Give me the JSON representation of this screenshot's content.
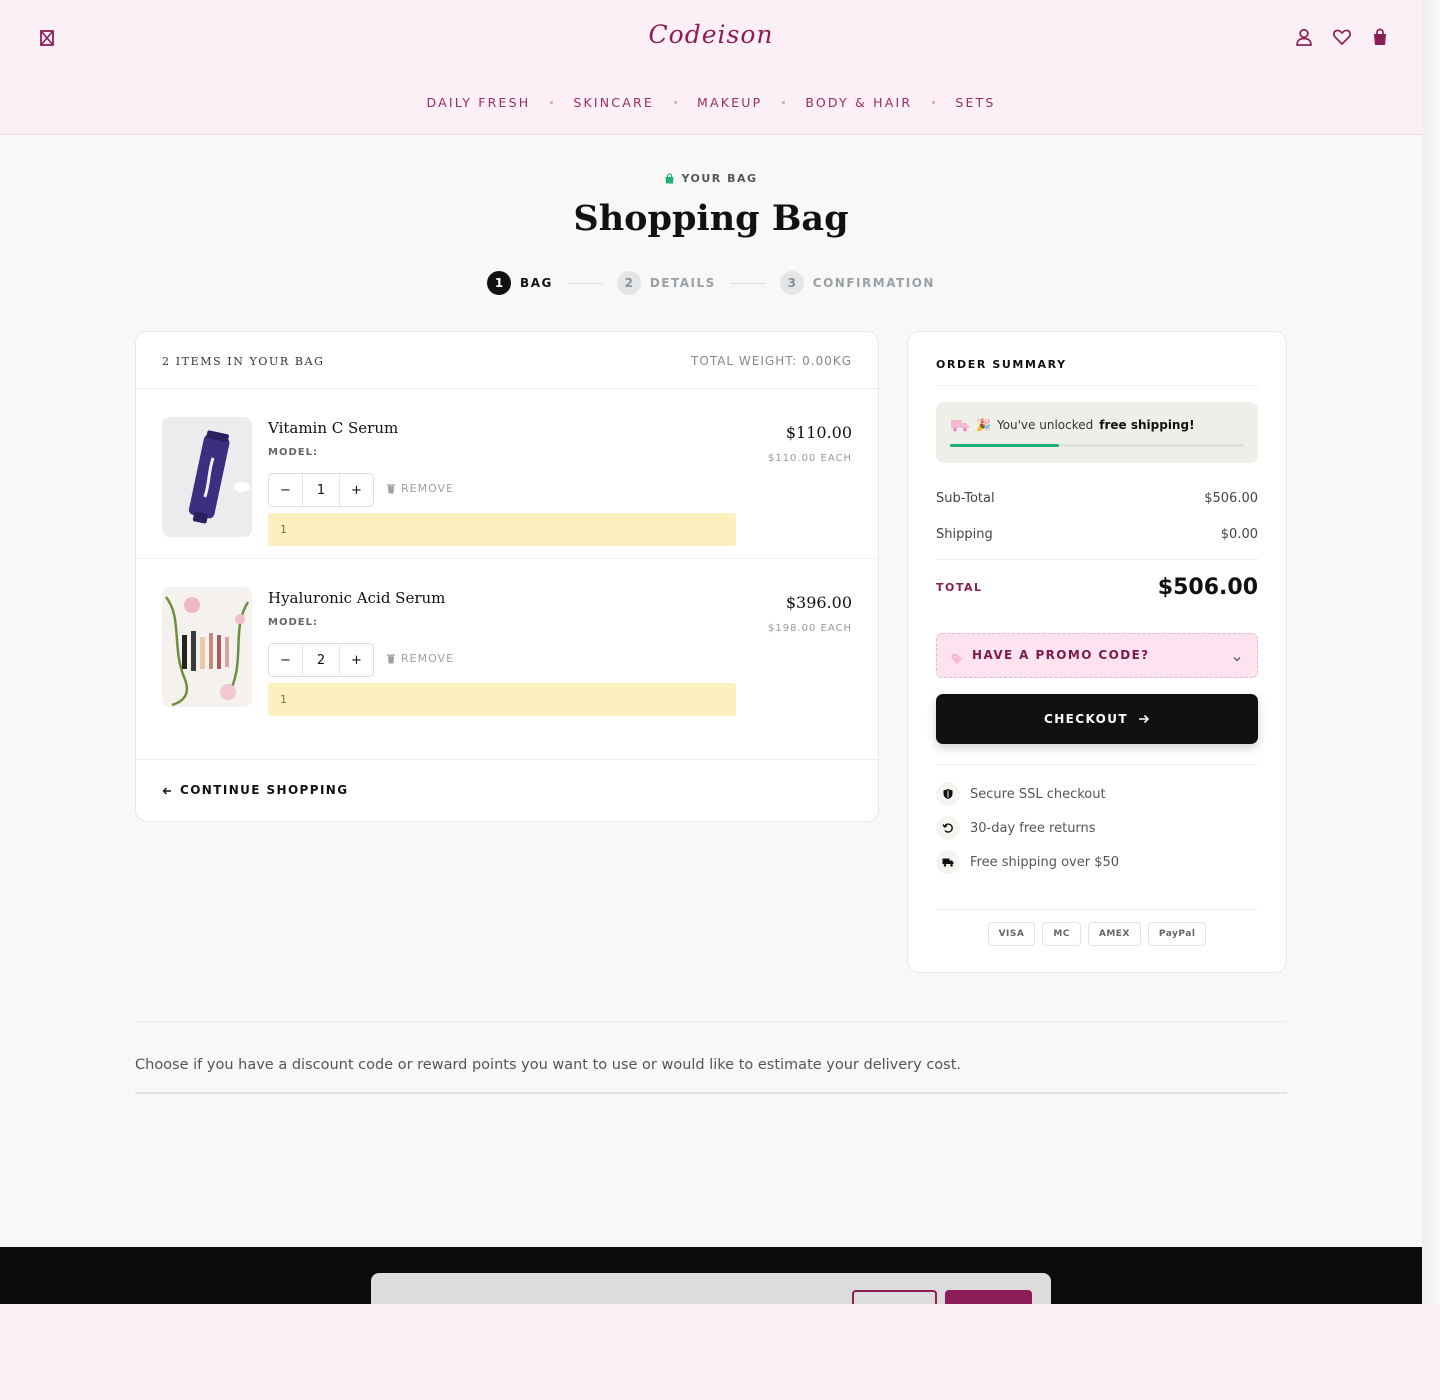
{
  "header": {
    "logo": "Codeison",
    "nav": [
      "DAILY FRESH",
      "SKINCARE",
      "MAKEUP",
      "BODY & HAIR",
      "SETS"
    ]
  },
  "page": {
    "eyebrow": "YOUR BAG",
    "title": "Shopping Bag",
    "steps": [
      {
        "num": "1",
        "label": "BAG"
      },
      {
        "num": "2",
        "label": "DETAILS"
      },
      {
        "num": "3",
        "label": "CONFIRMATION"
      }
    ]
  },
  "bag": {
    "count_label": "2 ITEMS IN YOUR BAG",
    "weight_label": "TOTAL WEIGHT: 0.00KG",
    "items": [
      {
        "name": "Vitamin C Serum",
        "model": "MODEL:",
        "qty": "1",
        "remove": "REMOVE",
        "note": "1",
        "price": "$110.00",
        "each": "$110.00 EACH"
      },
      {
        "name": "Hyaluronic Acid Serum",
        "model": "MODEL:",
        "qty": "2",
        "remove": "REMOVE",
        "note": "1",
        "price": "$396.00",
        "each": "$198.00 EACH"
      }
    ],
    "continue": "CONTINUE SHOPPING"
  },
  "summary": {
    "title": "ORDER SUMMARY",
    "ship_msg_pre": "You've unlocked",
    "ship_msg_bold": "free shipping!",
    "ship_progress": 0.37,
    "subtotal_label": "Sub-Total",
    "subtotal": "$506.00",
    "shipping_label": "Shipping",
    "shipping": "$0.00",
    "total_label": "TOTAL",
    "total": "$506.00",
    "promo": "HAVE A PROMO CODE?",
    "checkout": "CHECKOUT",
    "trust": [
      "Secure SSL checkout",
      "30-day free returns",
      "Free shipping over $50"
    ],
    "payments": [
      "VISA",
      "MC",
      "AMEX",
      "PayPal"
    ]
  },
  "info_text": "Choose if you have a discount code or reward points you want to use or would like to estimate your delivery cost.",
  "colors": {
    "brand": "#8c1d56",
    "accent_green": "#1db07a",
    "note_bg": "#fdf0c0",
    "promo_bg": "#fde2ef"
  }
}
